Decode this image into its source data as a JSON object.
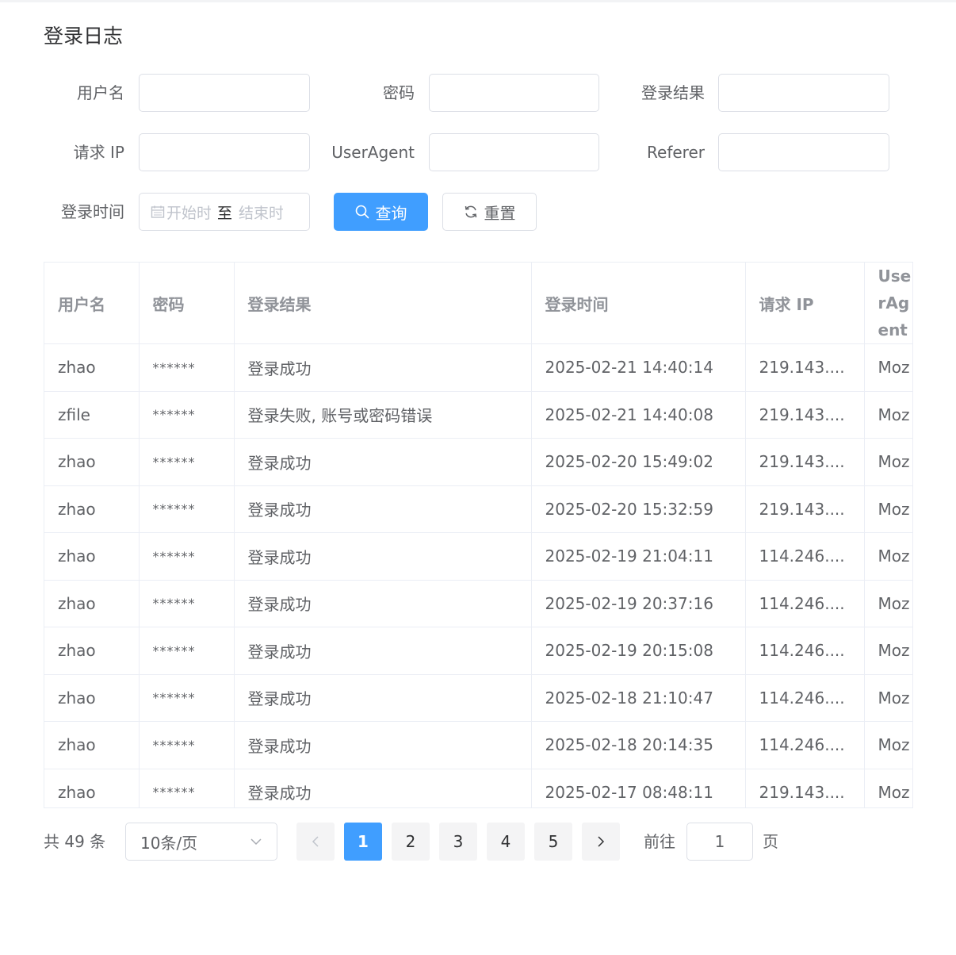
{
  "page": {
    "title": "登录日志"
  },
  "filters": {
    "username_label": "用户名",
    "password_label": "密码",
    "result_label": "登录结果",
    "ip_label": "请求 IP",
    "useragent_label": "UserAgent",
    "referer_label": "Referer",
    "time_label": "登录时间",
    "start_placeholder": "开始时间",
    "range_separator": "至",
    "end_placeholder": "结束时间"
  },
  "buttons": {
    "search": "查询",
    "reset": "重置"
  },
  "table": {
    "columns": [
      "用户名",
      "密码",
      "登录结果",
      "登录时间",
      "请求 IP",
      "UserAgent"
    ],
    "rows": [
      [
        "zhao",
        "******",
        "登录成功",
        "2025-02-21 14:40:14",
        "219.143....",
        "Moz"
      ],
      [
        "zfile",
        "******",
        "登录失败, 账号或密码错误",
        "2025-02-21 14:40:08",
        "219.143....",
        "Moz"
      ],
      [
        "zhao",
        "******",
        "登录成功",
        "2025-02-20 15:49:02",
        "219.143....",
        "Moz"
      ],
      [
        "zhao",
        "******",
        "登录成功",
        "2025-02-20 15:32:59",
        "219.143....",
        "Moz"
      ],
      [
        "zhao",
        "******",
        "登录成功",
        "2025-02-19 21:04:11",
        "114.246....",
        "Moz"
      ],
      [
        "zhao",
        "******",
        "登录成功",
        "2025-02-19 20:37:16",
        "114.246....",
        "Moz"
      ],
      [
        "zhao",
        "******",
        "登录成功",
        "2025-02-19 20:15:08",
        "114.246....",
        "Moz"
      ],
      [
        "zhao",
        "******",
        "登录成功",
        "2025-02-18 21:10:47",
        "114.246....",
        "Moz"
      ],
      [
        "zhao",
        "******",
        "登录成功",
        "2025-02-18 20:14:35",
        "114.246....",
        "Moz"
      ],
      [
        "zhao",
        "******",
        "登录成功",
        "2025-02-17 08:48:11",
        "219.143....",
        "Moz"
      ]
    ]
  },
  "pagination": {
    "total_text": "共 49 条",
    "page_size": "10条/页",
    "pages": [
      "1",
      "2",
      "3",
      "4",
      "5"
    ],
    "current": "1",
    "goto_label": "前往",
    "goto_value": "1",
    "page_suffix": "页"
  },
  "colors": {
    "primary": "#409eff",
    "border": "#dcdfe6"
  },
  "icons": {
    "search": "search-icon",
    "reset": "refresh-icon",
    "calendar": "calendar-icon",
    "select": "chevron-down-icon",
    "prev": "chevron-left-icon",
    "next": "chevron-right-icon"
  }
}
